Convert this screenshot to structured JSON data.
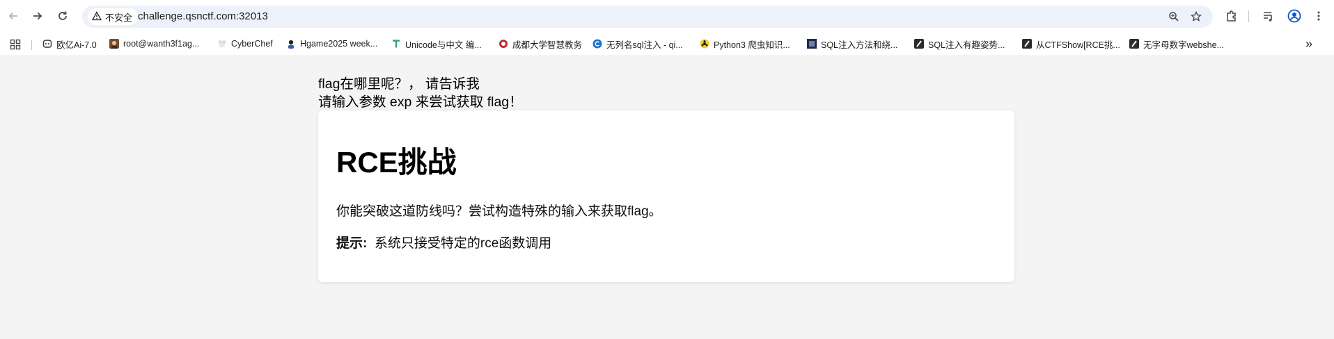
{
  "browser": {
    "security_label": "不安全",
    "url": "challenge.qsnctf.com:32013"
  },
  "bookmarks": {
    "apps_icon": "apps-grid-icon",
    "items": [
      {
        "label": "欧亿Ai-7.0"
      },
      {
        "label": "root@wanth3f1ag..."
      },
      {
        "label": "CyberChef"
      },
      {
        "label": "Hgame2025 week..."
      },
      {
        "label": "Unicode与中文 编..."
      },
      {
        "label": "成都大学智慧教务"
      },
      {
        "label": "无列名sql注入 - qi..."
      },
      {
        "label": "Python3 爬虫知识..."
      },
      {
        "label": "SQL注入方法和绕..."
      },
      {
        "label": "SQL注入有趣姿势..."
      },
      {
        "label": "从CTFShow[RCE挑..."
      },
      {
        "label": "无字母数字webshe..."
      }
    ],
    "overflow": "»"
  },
  "page": {
    "line1": "flag在哪里呢？， 请告诉我",
    "line2": "请输入参数 exp 来尝试获取 flag！",
    "card": {
      "title": "RCE挑战",
      "description": "你能突破这道防线吗？尝试构造特殊的输入来获取flag。",
      "tip_label": "提示:",
      "tip_text": "系统只接受特定的rce函数调用"
    }
  },
  "colors": {
    "page_bg": "#f4f4f4",
    "card_bg": "#ffffff",
    "omnibox_bg": "#edf1f9"
  }
}
